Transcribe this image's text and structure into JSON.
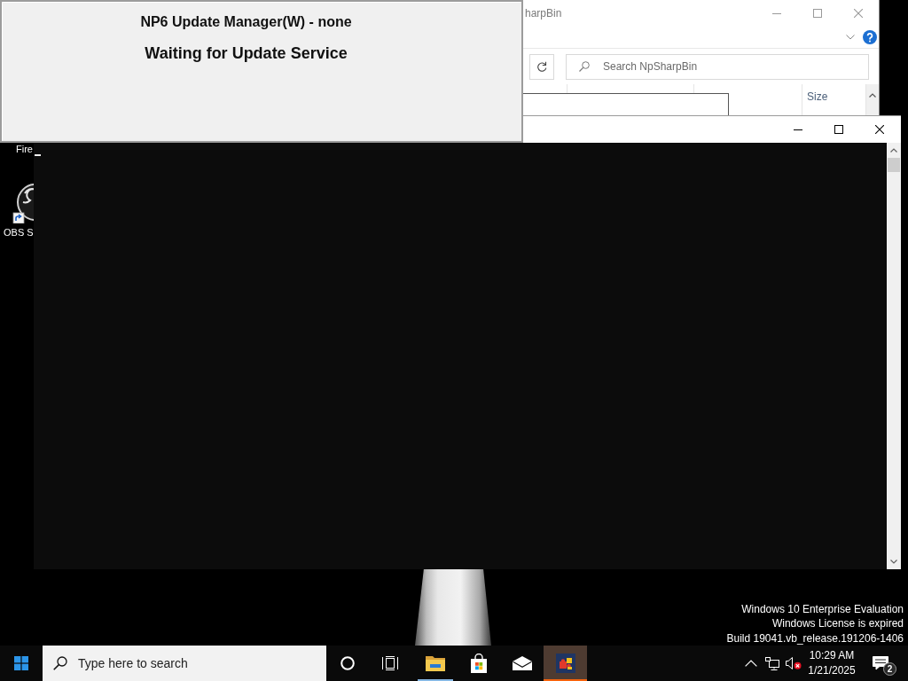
{
  "update_manager": {
    "title": "NP6 Update Manager(W) - none",
    "status": "Waiting for Update Service"
  },
  "desktop_icons": [
    {
      "kind": "label",
      "label": "Fire"
    },
    {
      "kind": "shortcut",
      "label": "OBS S"
    }
  ],
  "explorer_window": {
    "title": "harpBin",
    "search": {
      "placeholder": "Search NpSharpBin"
    },
    "columns": [
      "Size"
    ]
  },
  "desktop_notice": [
    "Windows 10 Enterprise Evaluation",
    "Windows License is expired",
    "Build 19041.vb_release.191206-1406"
  ],
  "taskbar": {
    "search": {
      "placeholder": "Type here to search"
    },
    "apps": [
      {
        "kind": "folder",
        "running": true,
        "flashing": false
      },
      {
        "kind": "store",
        "running": false,
        "flashing": false
      },
      {
        "kind": "mail",
        "running": false,
        "flashing": false
      },
      {
        "kind": "puzzle",
        "running": true,
        "flashing": true
      }
    ],
    "tray": {
      "volume_muted": true,
      "clock": {
        "time": "10:29 AM",
        "date": "1/21/2025"
      },
      "notification_count": "2"
    }
  }
}
